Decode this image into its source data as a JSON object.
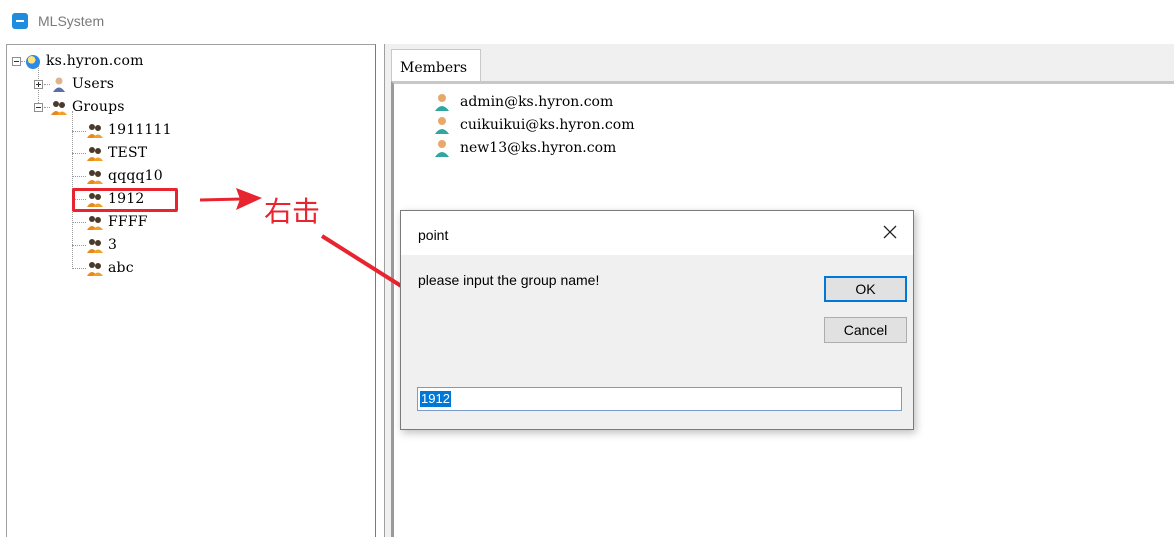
{
  "window": {
    "title": "MLSystem"
  },
  "tree": {
    "root": "ks.hyron.com",
    "users": "Users",
    "groups": "Groups",
    "group_items": [
      "1911111",
      "TEST",
      "qqqq10",
      "1912",
      "FFFF",
      "3",
      "abc"
    ],
    "highlighted": "1912"
  },
  "annotation": {
    "text": "右击"
  },
  "tabs": {
    "members": "Members"
  },
  "members": [
    "admin@ks.hyron.com",
    "cuikuikui@ks.hyron.com",
    "new13@ks.hyron.com"
  ],
  "dialog": {
    "title": "point",
    "message": "please input the group name!",
    "ok": "OK",
    "cancel": "Cancel",
    "input_value": "1912"
  },
  "colors": {
    "accent": "#0078d7",
    "annotation": "#e8242f"
  }
}
